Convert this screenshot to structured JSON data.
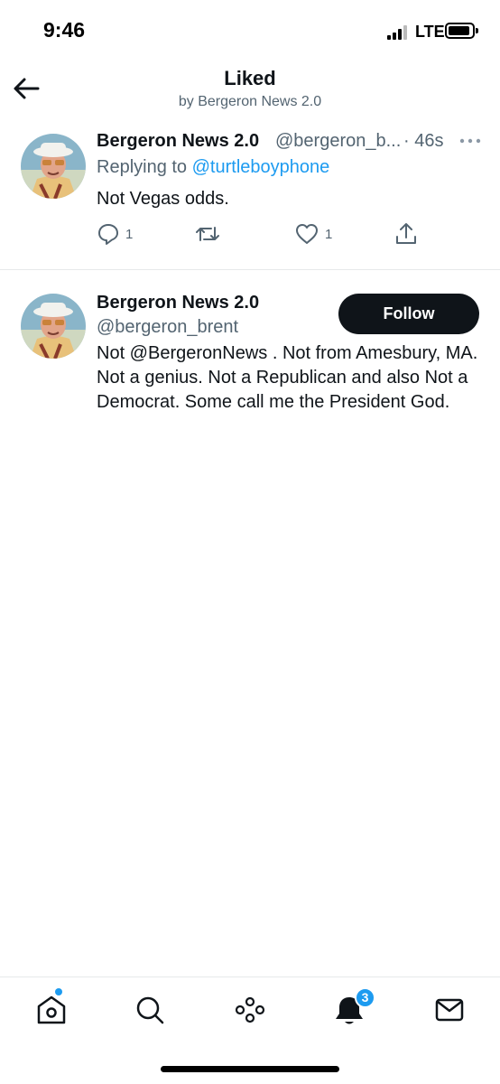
{
  "status_bar": {
    "time": "9:46",
    "network": "LTE"
  },
  "header": {
    "title": "Liked",
    "subtitle": "by Bergeron News 2.0"
  },
  "tweet": {
    "name": "Bergeron News 2.0",
    "handle": "@bergeron_b...",
    "time": "· 46s",
    "replying_prefix": "Replying to ",
    "replying_to": "@turtleboyphone",
    "text": "Not Vegas odds.",
    "reply_count": "1",
    "like_count": "1"
  },
  "user": {
    "name": "Bergeron News 2.0",
    "handle": "@bergeron_brent",
    "follow_label": "Follow",
    "bio": "Not @BergeronNews . Not from Amesbury, MA. Not a genius. Not a Republican and also Not a Democrat. Some call me the President God."
  },
  "tabbar": {
    "items": [
      "home-icon",
      "search-icon",
      "spaces-icon",
      "notifications-icon",
      "messages-icon"
    ],
    "notifications_badge": "3"
  },
  "colors": {
    "accent": "#1d9bf0",
    "text": "#0f1419",
    "secondary": "#536471",
    "divider": "#e7e9ea"
  }
}
